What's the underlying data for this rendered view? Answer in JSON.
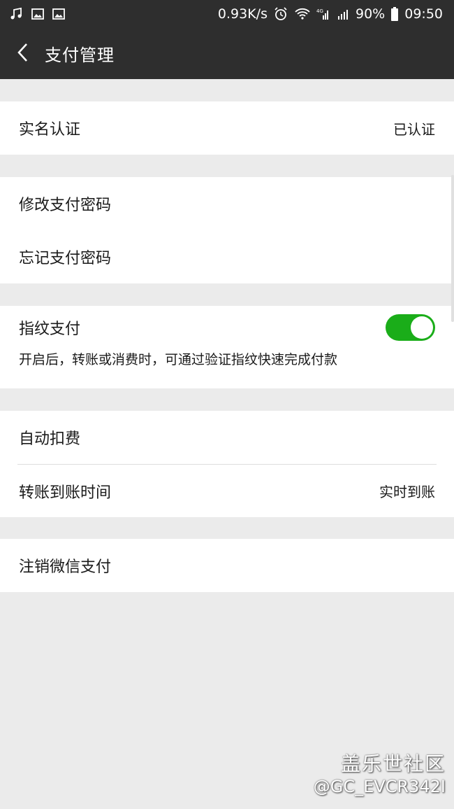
{
  "status_bar": {
    "speed": "0.93K/s",
    "battery": "90%",
    "time": "09:50",
    "icons_left": [
      "music-icon",
      "image-icon",
      "image-icon"
    ],
    "icons_right": [
      "alarm-icon",
      "wifi-icon",
      "signal-4g-icon",
      "signal-icon",
      "battery-icon"
    ]
  },
  "header": {
    "title": "支付管理",
    "back_icon": "chevron-left-icon"
  },
  "groups": {
    "verification": {
      "label": "实名认证",
      "value": "已认证"
    },
    "password": {
      "change_label": "修改支付密码",
      "forgot_label": "忘记支付密码"
    },
    "fingerprint": {
      "label": "指纹支付",
      "enabled": true,
      "description": "开启后，转账或消费时，可通过验证指纹快速完成付款"
    },
    "payment": {
      "auto_deduct_label": "自动扣费",
      "transfer_time_label": "转账到账时间",
      "transfer_time_value": "实时到账"
    },
    "cancel": {
      "label": "注销微信支付"
    }
  },
  "watermark": {
    "name": "盖乐世社区",
    "user": "@GC_EVCR342I"
  },
  "colors": {
    "header_bg": "#2e2e2e",
    "page_bg": "#ebebeb",
    "toggle_on": "#1aad19"
  }
}
